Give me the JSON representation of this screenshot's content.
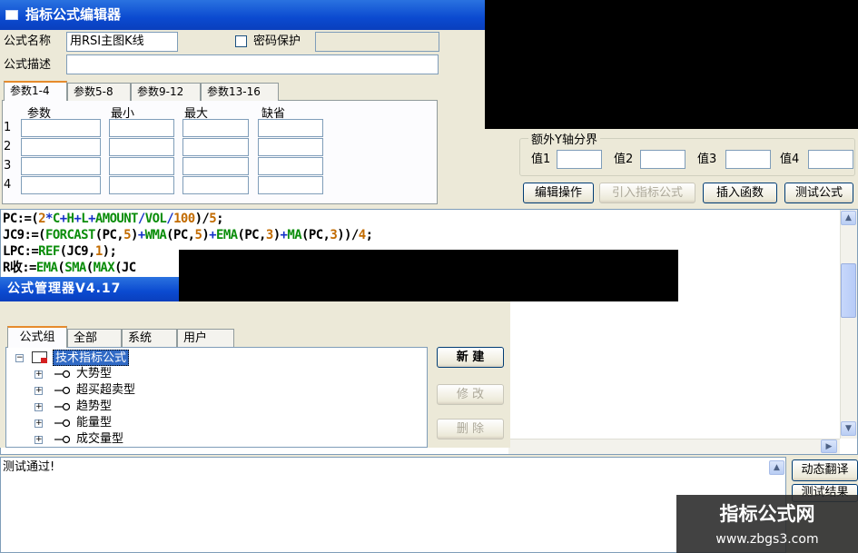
{
  "window": {
    "title": "指标公式编辑器"
  },
  "form": {
    "name_label": "公式名称",
    "name_value": "用RSI主图K线",
    "password_label": "密码保护",
    "desc_label": "公式描述",
    "desc_value": ""
  },
  "param_tabs": [
    "参数1-4",
    "参数5-8",
    "参数9-12",
    "参数13-16"
  ],
  "param_grid": {
    "headers": [
      "参数",
      "最小",
      "最大",
      "缺省"
    ],
    "rows": [
      "1",
      "2",
      "3",
      "4"
    ]
  },
  "y_axis": {
    "title": "额外Y轴分界",
    "labels": [
      "值1",
      "值2",
      "值3",
      "值4"
    ]
  },
  "buttons": {
    "edit_ops": "编辑操作",
    "import_formula": "引入指标公式",
    "insert_function": "插入函数",
    "test_formula": "测试公式"
  },
  "code": {
    "lines": [
      [
        [
          "v",
          "PC:=("
        ],
        [
          "n",
          "2"
        ],
        [
          "o",
          "*"
        ],
        [
          "f",
          "C"
        ],
        [
          "o",
          "+"
        ],
        [
          "f",
          "H"
        ],
        [
          "o",
          "+"
        ],
        [
          "f",
          "L"
        ],
        [
          "o",
          "+"
        ],
        [
          "f",
          "AMOUNT"
        ],
        [
          "o",
          "/"
        ],
        [
          "f",
          "VOL"
        ],
        [
          "o",
          "/"
        ],
        [
          "n",
          "100"
        ],
        [
          "v",
          ")/"
        ],
        [
          "n",
          "5"
        ],
        [
          "v",
          ";"
        ]
      ],
      [
        [
          "v",
          "JC9:=("
        ],
        [
          "f",
          "FORCAST"
        ],
        [
          "v",
          "(PC,"
        ],
        [
          "n",
          "5"
        ],
        [
          "v",
          ")"
        ],
        [
          "o",
          "+"
        ],
        [
          "f",
          "WMA"
        ],
        [
          "v",
          "(PC,"
        ],
        [
          "n",
          "5"
        ],
        [
          "v",
          ")"
        ],
        [
          "o",
          "+"
        ],
        [
          "f",
          "EMA"
        ],
        [
          "v",
          "(PC,"
        ],
        [
          "n",
          "3"
        ],
        [
          "v",
          ")"
        ],
        [
          "o",
          "+"
        ],
        [
          "f",
          "MA"
        ],
        [
          "v",
          "(PC,"
        ],
        [
          "n",
          "3"
        ],
        [
          "v",
          "))/"
        ],
        [
          "n",
          "4"
        ],
        [
          "v",
          ";"
        ]
      ],
      [
        [
          "v",
          "LPC:="
        ],
        [
          "f",
          "REF"
        ],
        [
          "v",
          "(JC9,"
        ],
        [
          "n",
          "1"
        ],
        [
          "v",
          ");"
        ]
      ],
      [
        [
          "v",
          "R收:="
        ],
        [
          "f",
          "EMA"
        ],
        [
          "v",
          "("
        ],
        [
          "f",
          "SMA"
        ],
        [
          "v",
          "("
        ],
        [
          "f",
          "MAX"
        ],
        [
          "v",
          "(JC"
        ]
      ]
    ]
  },
  "manager": {
    "title": "公式管理器V4.17",
    "tabs": [
      "公式组",
      "全部",
      "系统",
      "用户"
    ],
    "tree_root": "技术指标公式",
    "tree_items": [
      "大势型",
      "超买超卖型",
      "趋势型",
      "能量型",
      "成交量型"
    ],
    "buttons": {
      "new": "新  建",
      "modify": "修  改",
      "delete": "删  除"
    }
  },
  "status": {
    "message": "测试通过!"
  },
  "side_buttons": {
    "translate": "动态翻译",
    "test_result": "测试结果"
  },
  "watermark": {
    "title": "指标公式网",
    "url": "www.zbgs3.com"
  },
  "colors": {
    "titlebar": "#0b4ad0",
    "function": "#0a8d0a",
    "operator": "#1432c8",
    "number": "#c26b00",
    "tab_highlight": "#e68b2c"
  }
}
